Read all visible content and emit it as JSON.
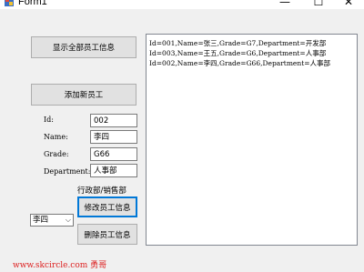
{
  "window": {
    "title": "Form1",
    "minimize_glyph": "—",
    "maximize_glyph": "☐",
    "close_glyph": "✕"
  },
  "buttons": {
    "show_all": "显示全部员工信息",
    "add_new": "添加新员工",
    "modify": "修改员工信息",
    "delete": "删除员工信息"
  },
  "form": {
    "id_label": "Id:",
    "id_value": "002",
    "name_label": "Name:",
    "name_value": "李四",
    "grade_label": "Grade:",
    "grade_value": "G66",
    "department_label": "Department:",
    "department_value": "人事部",
    "department_hint": "行政部/销售部"
  },
  "combo": {
    "selected": "李四",
    "arrow_icon": "chevron-down-icon"
  },
  "list": {
    "items": [
      "Id=001,Name=张三,Grade=G7,Department=开发部",
      "Id=003,Name=王五,Grade=G6,Department=人事部",
      "Id=002,Name=李四,Grade=G66,Department=人事部"
    ]
  },
  "watermark": "www.skcircle.com 勇哥"
}
